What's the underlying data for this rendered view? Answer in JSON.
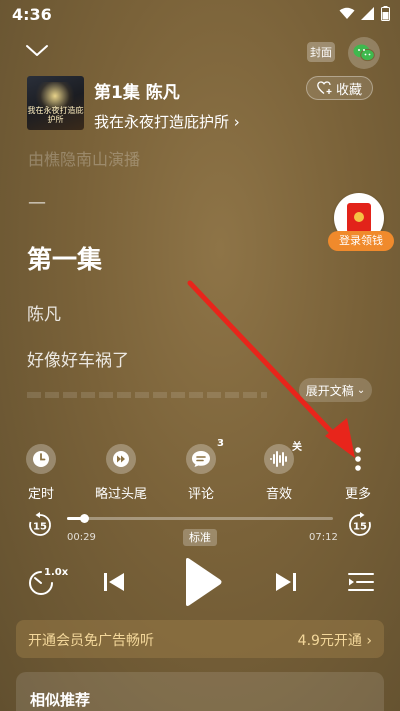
{
  "status": {
    "time": "4:36"
  },
  "top_bar": {
    "cover_label": "封面"
  },
  "header": {
    "cover_art_text": "我在永夜打造庇护所",
    "episode_title": "第1集 陈凡",
    "album_name": "我在永夜打造庇护所",
    "collect_label": "收藏"
  },
  "content": {
    "announcer": "由樵隐南山演播",
    "dash": "—",
    "chapter_title": "第一集",
    "line_author": "陈凡",
    "line_text": "好像好车祸了",
    "expand_label": "展开文稿"
  },
  "redpacket": {
    "label": "登录领钱"
  },
  "functions": [
    {
      "label": "定时",
      "icon": "clock-icon"
    },
    {
      "label": "略过头尾",
      "icon": "skip-intro-icon"
    },
    {
      "label": "评论",
      "icon": "comment-icon",
      "badge": "3"
    },
    {
      "label": "音效",
      "icon": "sound-effect-icon",
      "badge": "关"
    },
    {
      "label": "更多",
      "icon": "more-icon"
    }
  ],
  "progress": {
    "current": "00:29",
    "total": "07:12",
    "quality": "标准",
    "fraction": 0.067,
    "rewind_seconds": "15",
    "forward_seconds": "15"
  },
  "controls": {
    "speed": "1.0x"
  },
  "vip": {
    "text": "开通会员免广告畅听",
    "price": "4.9元开通"
  },
  "similar": {
    "title": "相似推荐"
  },
  "colors": {
    "accent_gold": "#f3d79a",
    "annotation_arrow": "#e8251b",
    "redpacket_orange": "#f08a2c"
  }
}
